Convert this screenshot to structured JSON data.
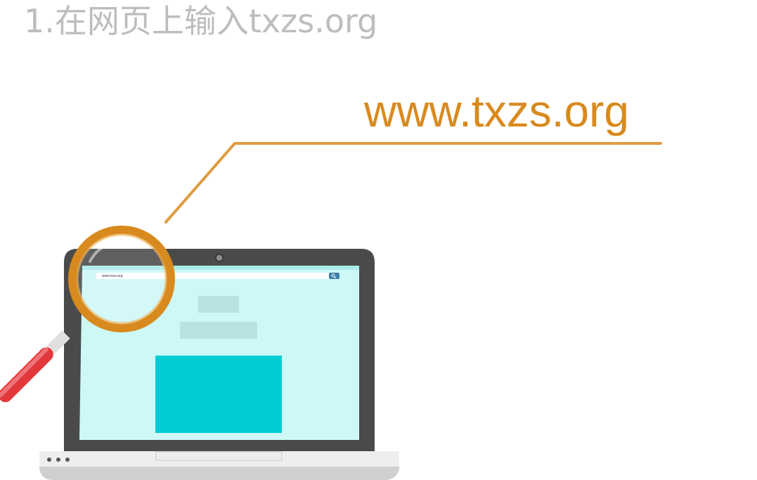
{
  "step_title": "1.在网页上输入txzs.org",
  "callout_url": "www.txzs.org",
  "laptop_screen": {
    "address_bar_text": "www.txzs.org"
  },
  "colors": {
    "title_gray": "#bdbdbd",
    "accent_orange": "#d88a1e",
    "screen_bg": "#cdf8f6",
    "content_block": "#00ccd6",
    "magnifier_handle": "#e2373b",
    "laptop_bezel": "#4a4a4a"
  },
  "icons": {
    "search": "search-icon",
    "magnifier": "magnifying-glass-icon"
  }
}
